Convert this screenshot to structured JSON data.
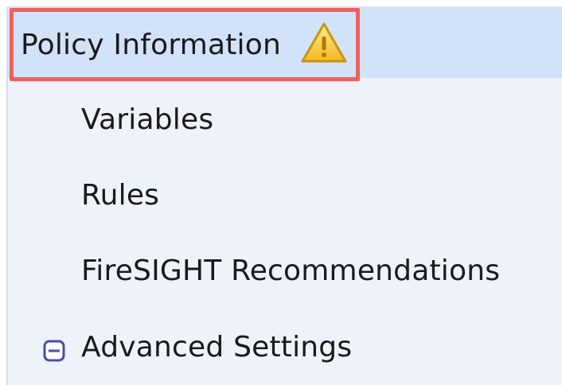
{
  "nav": {
    "header": {
      "label": "Policy Information",
      "warning_icon": "warning-triangle-icon"
    },
    "items": [
      {
        "label": "Variables"
      },
      {
        "label": "Rules"
      },
      {
        "label": "FireSIGHT Recommendations"
      },
      {
        "label": "Advanced Settings",
        "expand_state": "expanded",
        "toggle_icon": "collapse-minus-icon"
      }
    ]
  },
  "colors": {
    "header_background": "#d2e2f8",
    "panel_background": "#eef2f9",
    "highlight_border": "#f0605b",
    "warning_yellow": "#f5c531"
  }
}
